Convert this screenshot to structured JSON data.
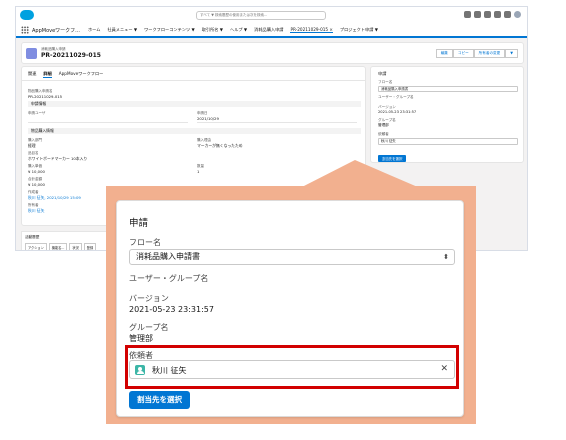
{
  "global": {
    "search_placeholder": "すべて  ▼  検索履歴の使用または次を検索..."
  },
  "app_nav": {
    "app_name": "AppMoveワークフ...",
    "items": [
      {
        "label": "ホーム"
      },
      {
        "label": "社員メニュー ▼"
      },
      {
        "label": "ワークフローコンテンツ ▼"
      },
      {
        "label": "取引所名 ▼"
      },
      {
        "label": "ヘルプ ▼"
      },
      {
        "label": "消耗品購入申請"
      },
      {
        "label": "プロジェクト申請 ▼"
      }
    ],
    "active_tab": "PR-20211029-015  ×"
  },
  "record_header": {
    "object_label": "消耗品購入申請",
    "record_number": "PR-20211029-015",
    "buttons": [
      "編集",
      "コピー",
      "所有者の変更",
      "▼"
    ]
  },
  "left_card": {
    "tabs": [
      "関連",
      "詳細",
      "AppMoveワークフロー"
    ],
    "active_tab": "詳細",
    "fields": [
      {
        "label": "物品購入申請名",
        "value": "PR-20211029-015"
      },
      {
        "label": "申請ユーザ",
        "value": ""
      },
      {
        "label": "申請日",
        "value": "2021/10/29"
      },
      {
        "label": "購入部門",
        "value": "経理"
      },
      {
        "label": "購入理由",
        "value": "マーカーが無くなったため"
      },
      {
        "label": "品目名",
        "value": "ホワイトボードマーカー 10本入り"
      },
      {
        "label": "購入単価",
        "value": "¥ 10,000"
      },
      {
        "label": "数量",
        "value": "1"
      },
      {
        "label": "合計金額",
        "value": "¥ 10,000"
      },
      {
        "label": "作成者",
        "value": "秋川 征矢, 2021/10/29 15:09"
      },
      {
        "label": "所有者",
        "value": "秋川 征矢"
      }
    ],
    "sections": [
      "申請情報",
      "物品購入情報"
    ]
  },
  "activity": {
    "title": "活動履歴",
    "buttons": [
      "アクション",
      "機能名...",
      "状況",
      "登録"
    ]
  },
  "right_card_small": {
    "title": "申請",
    "flow_label": "フロー名",
    "flow_value": "消耗品購入申請書",
    "group_label": "ユーザー・グループ名",
    "version_label": "バージョン",
    "version_value": "2021-05-23 23:31:57",
    "group_name_label": "グループ名",
    "group_name_value": "管理部",
    "requester_label": "依頼者",
    "requester_value": "秋川 征矢",
    "assign_button": "割当先を選択"
  },
  "panel": {
    "title": "申請",
    "flow_label": "フロー名",
    "flow_value": "消耗品購入申請書",
    "group_label": "ユーザー・グループ名",
    "version_label": "バージョン",
    "version_value": "2021-05-23 23:31:57",
    "group_name_label": "グループ名",
    "group_name_value": "管理部",
    "requester_label": "依頼者",
    "requester_value": "秋川 征矢",
    "clear_icon": "close-icon",
    "assign_button": "割当先を選択"
  },
  "colors": {
    "brand_blue": "#0176d3",
    "highlight_red": "#d20000",
    "callout_fill": "#f2b08f",
    "contact_icon": "#3cb6a7"
  }
}
